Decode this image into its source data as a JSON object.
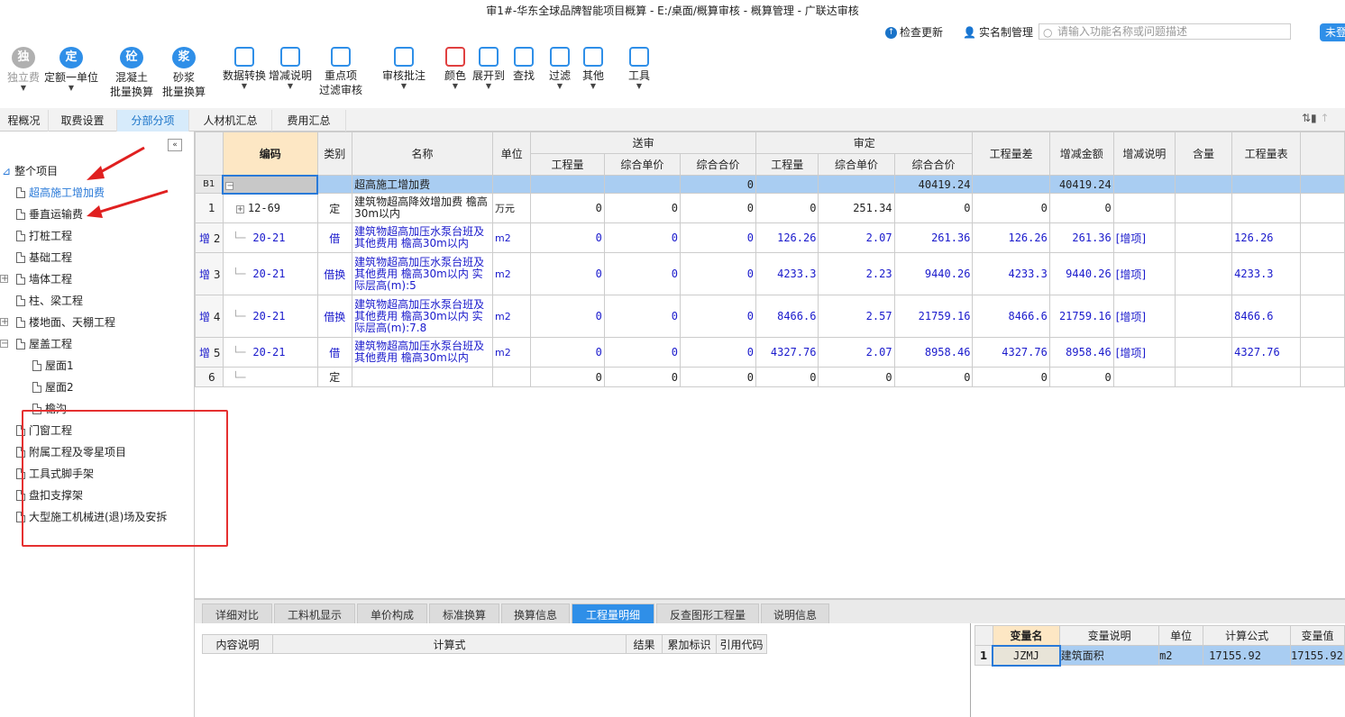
{
  "window": {
    "title": "审1#-华东全球品牌智能项目概算 - E:/桌面/概算审核 - 概算管理 - 广联达审核"
  },
  "topbar": {
    "check_update": "检查更新",
    "realname": "实名制管理",
    "search_placeholder": "请输入功能名称或问题描述",
    "login": "未登"
  },
  "ribbon": [
    {
      "label": "独立费",
      "icon": "独",
      "color": "#b0b0b0"
    },
    {
      "label": "定额一单位",
      "icon": "定",
      "color": "#2f8fe8"
    },
    {
      "label": "混凝土\n批量换算",
      "icon": "砼",
      "color": "#2f8fe8"
    },
    {
      "label": "砂浆\n批量换算",
      "icon": "浆",
      "color": "#2f8fe8"
    },
    {
      "label": "数据转换",
      "icon": "data-convert-icon",
      "color": "#2f8fe8"
    },
    {
      "label": "增减说明",
      "icon": "note-icon",
      "color": "#2f8fe8"
    },
    {
      "label": "重点项\n过滤审核",
      "icon": "filter-audit-icon",
      "color": "#2f8fe8"
    },
    {
      "label": "审核批注",
      "icon": "annotate-icon",
      "color": "#2f8fe8"
    },
    {
      "label": "颜色",
      "icon": "color-icon",
      "color": "#e04040"
    },
    {
      "label": "展开到",
      "icon": "expand-icon",
      "color": "#2f8fe8"
    },
    {
      "label": "查找",
      "icon": "find-icon",
      "color": "#2f8fe8"
    },
    {
      "label": "过滤",
      "icon": "filter-icon",
      "color": "#2f8fe8"
    },
    {
      "label": "其他",
      "icon": "other-icon",
      "color": "#2f8fe8"
    },
    {
      "label": "工具",
      "icon": "tools-icon",
      "color": "#2f8fe8"
    }
  ],
  "tabs": [
    "程概况",
    "取费设置",
    "分部分项",
    "人材机汇总",
    "费用汇总"
  ],
  "active_tab": "分部分项",
  "tree": [
    {
      "label": "整个项目",
      "level": 0
    },
    {
      "label": "超高施工增加费",
      "level": 1,
      "selected": true
    },
    {
      "label": "垂直运输费",
      "level": 1
    },
    {
      "label": "打桩工程",
      "level": 1
    },
    {
      "label": "基础工程",
      "level": 1
    },
    {
      "label": "墙体工程",
      "level": 1
    },
    {
      "label": "柱、梁工程",
      "level": 1
    },
    {
      "label": "楼地面、天棚工程",
      "level": 1
    },
    {
      "label": "屋盖工程",
      "level": 1
    },
    {
      "label": "屋面1",
      "level": 2
    },
    {
      "label": "屋面2",
      "level": 2
    },
    {
      "label": "檐沟",
      "level": 2
    },
    {
      "label": "门窗工程",
      "level": 1
    },
    {
      "label": "附属工程及零星项目",
      "level": 1
    },
    {
      "label": "工具式脚手架",
      "level": 1
    },
    {
      "label": "盘扣支撑架",
      "level": 1
    },
    {
      "label": "大型施工机械进(退)场及安拆",
      "level": 1
    }
  ],
  "grid": {
    "headers": {
      "code": "编码",
      "type": "类别",
      "name": "名称",
      "unit": "单位",
      "submitted": "送审",
      "approved": "审定",
      "qty": "工程量",
      "unit_price": "综合单价",
      "total": "综合合价",
      "qty_diff": "工程量差",
      "amount_diff": "增减金额",
      "diff_note": "增减说明",
      "content": "含量",
      "qty_expr": "工程量表"
    },
    "section": {
      "id": "B1",
      "name": "超高施工增加费",
      "s_total": "0",
      "a_total": "40419.24",
      "diff": "40419.24"
    },
    "rows": [
      {
        "id": "1",
        "flag": "",
        "code": "12-69",
        "type": "定",
        "name": "建筑物超高降效增加费 檐高30m以内",
        "unit": "万元",
        "s_qty": "0",
        "s_price": "0",
        "s_total": "0",
        "a_qty": "0",
        "a_price": "251.34",
        "a_total": "0",
        "qty_diff": "0",
        "amt_diff": "0",
        "note": "",
        "expr": ""
      },
      {
        "id": "2",
        "flag": "增",
        "code": "20-21",
        "type": "借",
        "name": "建筑物超高加压水泵台班及其他费用 檐高30m以内",
        "unit": "m2",
        "s_qty": "0",
        "s_price": "0",
        "s_total": "0",
        "a_qty": "126.26",
        "a_price": "2.07",
        "a_total": "261.36",
        "qty_diff": "126.26",
        "amt_diff": "261.36",
        "note": "[增项]",
        "expr": "126.26"
      },
      {
        "id": "3",
        "flag": "增",
        "code": "20-21",
        "type": "借换",
        "name": "建筑物超高加压水泵台班及其他费用 檐高30m以内  实际层高(m):5",
        "unit": "m2",
        "s_qty": "0",
        "s_price": "0",
        "s_total": "0",
        "a_qty": "4233.3",
        "a_price": "2.23",
        "a_total": "9440.26",
        "qty_diff": "4233.3",
        "amt_diff": "9440.26",
        "note": "[增项]",
        "expr": "4233.3"
      },
      {
        "id": "4",
        "flag": "增",
        "code": "20-21",
        "type": "借换",
        "name": "建筑物超高加压水泵台班及其他费用 檐高30m以内  实际层高(m):7.8",
        "unit": "m2",
        "s_qty": "0",
        "s_price": "0",
        "s_total": "0",
        "a_qty": "8466.6",
        "a_price": "2.57",
        "a_total": "21759.16",
        "qty_diff": "8466.6",
        "amt_diff": "21759.16",
        "note": "[增项]",
        "expr": "8466.6"
      },
      {
        "id": "5",
        "flag": "增",
        "code": "20-21",
        "type": "借",
        "name": "建筑物超高加压水泵台班及其他费用 檐高30m以内",
        "unit": "m2",
        "s_qty": "0",
        "s_price": "0",
        "s_total": "0",
        "a_qty": "4327.76",
        "a_price": "2.07",
        "a_total": "8958.46",
        "qty_diff": "4327.76",
        "amt_diff": "8958.46",
        "note": "[增项]",
        "expr": "4327.76"
      },
      {
        "id": "6",
        "flag": "",
        "code": "",
        "type": "定",
        "name": "",
        "unit": "",
        "s_qty": "0",
        "s_price": "0",
        "s_total": "0",
        "a_qty": "0",
        "a_price": "0",
        "a_total": "0",
        "qty_diff": "0",
        "amt_diff": "0",
        "note": "",
        "expr": ""
      }
    ]
  },
  "bottom_tabs": [
    "详细对比",
    "工料机显示",
    "单价构成",
    "标准换算",
    "换算信息",
    "工程量明细",
    "反查图形工程量",
    "说明信息"
  ],
  "active_bottom_tab": "工程量明细",
  "detail_headers": [
    "内容说明",
    "计算式",
    "结果",
    "累加标识",
    "引用代码"
  ],
  "vars": {
    "headers": [
      "变量名",
      "变量说明",
      "单位",
      "计算公式",
      "变量值"
    ],
    "rows": [
      {
        "id": "1",
        "name": "JZMJ",
        "desc": "建筑面积",
        "unit": "m2",
        "formula": "17155.92",
        "value": "17155.92"
      }
    ]
  }
}
